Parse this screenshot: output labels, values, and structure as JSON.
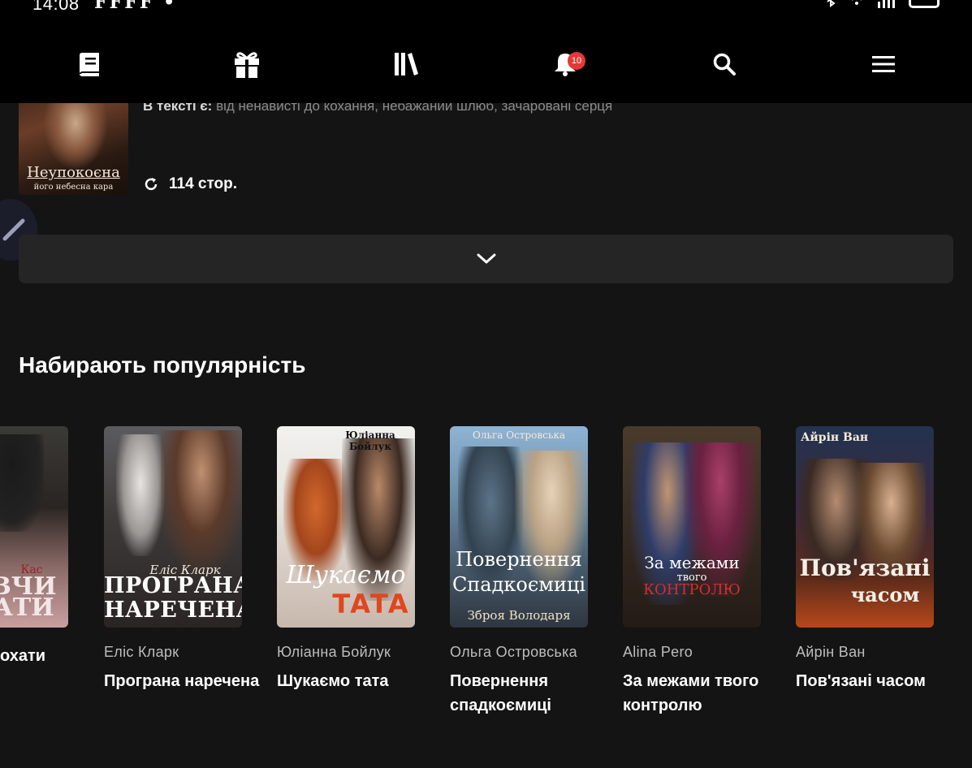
{
  "status_bar": {
    "time": "14:08",
    "notification_marks": "𝐅𝐅𝐅𝐅 •"
  },
  "nav": {
    "notification_count": "10",
    "items": [
      {
        "icon": "book-icon"
      },
      {
        "icon": "gift-icon"
      },
      {
        "icon": "library-icon"
      },
      {
        "icon": "bell-icon"
      },
      {
        "icon": "search-icon"
      },
      {
        "icon": "menu-icon"
      }
    ]
  },
  "current_book": {
    "cover_title": "Неупокоєна",
    "cover_subtitle": "його небесна кара",
    "tags_label": "В тексті є:",
    "tags": "від ненависті до кохання, небажаний шлюб, зачаровані серця",
    "pages": "114 стор."
  },
  "section": {
    "title": "Набирають популярність"
  },
  "books": [
    {
      "author": "",
      "title": "охати",
      "cover_text_1": "Кас",
      "cover_text_2": "ВЧИ",
      "cover_text_3": "АТИ"
    },
    {
      "author": "Еліс Кларк",
      "title": "Програна наречена",
      "cover_author": "Еліс Кларк",
      "cover_title_1": "ПРОГРАНА",
      "cover_title_2": "НАРЕЧЕНА"
    },
    {
      "author": "Юліанна Бойлук",
      "title": "Шукаємо тата",
      "cover_author": "Юліанна Бойлук",
      "cover_title_1": "Шукаємо",
      "cover_title_2": "ТАТА"
    },
    {
      "author": "Ольга Островська",
      "title": "Повернення спадкоємиці",
      "cover_author": "Ольга Островська",
      "cover_title_1": "Повернення",
      "cover_title_2": "Спадкоємиці",
      "cover_title_3": "Зброя Володаря"
    },
    {
      "author": "Alina Pero",
      "title": "За межами твого контролю",
      "cover_title_1": "За межами",
      "cover_title_2": "твого",
      "cover_title_3": "КОНТРОЛЮ"
    },
    {
      "author": "Айрін Ван",
      "title": "Пов'язані часом",
      "cover_author": "Айрін Ван",
      "cover_title_1": "Пов'язані",
      "cover_title_2": "часом"
    }
  ],
  "colors": {
    "background": "#141414",
    "topbar": "#000000",
    "badge": "#e53935",
    "expand_bar": "#252525"
  }
}
